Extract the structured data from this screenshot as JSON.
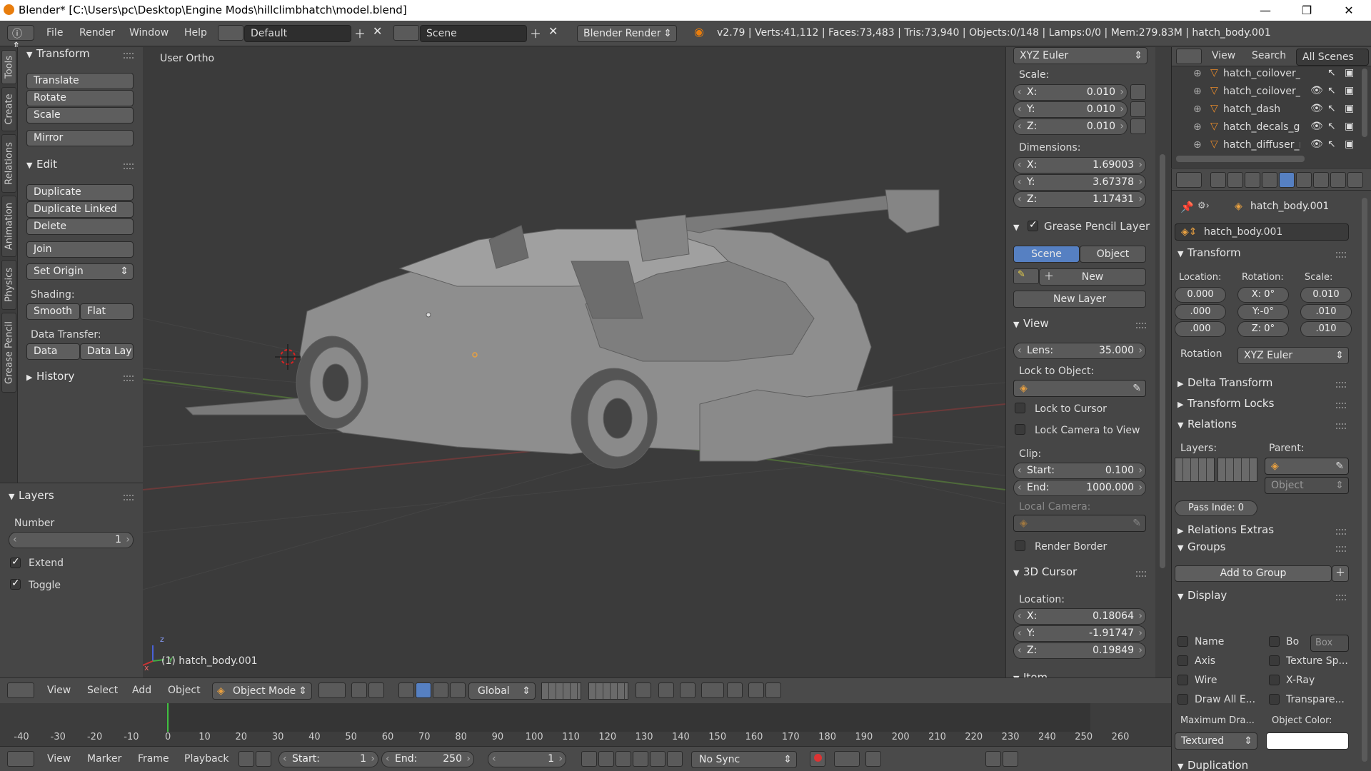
{
  "window": {
    "title": "Blender* [C:\\Users\\pc\\Desktop\\Engine Mods\\hillclimbhatch\\model.blend]",
    "minimize": "—",
    "maximize": "❐",
    "close": "✕"
  },
  "info_header": {
    "menus": [
      "File",
      "Render",
      "Window",
      "Help"
    ],
    "layout": "Default",
    "scene": "Scene",
    "engine": "Blender Render",
    "stats": "v2.79 | Verts:41,112 | Faces:73,483 | Tris:73,940 | Objects:0/148 | Lamps:0/0 | Mem:279.83M | hatch_body.001"
  },
  "side_tabs": [
    "Tools",
    "Create",
    "Relations",
    "Animation",
    "Physics",
    "Grease Pencil"
  ],
  "tool_shelf": {
    "transform": {
      "title": "Transform",
      "buttons": [
        "Translate",
        "Rotate",
        "Scale",
        "Mirror"
      ]
    },
    "edit": {
      "title": "Edit",
      "buttons": [
        "Duplicate",
        "Duplicate Linked",
        "Delete",
        "Join"
      ],
      "set_origin": "Set Origin"
    },
    "shading": {
      "label": "Shading:",
      "smooth": "Smooth",
      "flat": "Flat"
    },
    "data_transfer": {
      "label": "Data Transfer:",
      "data": "Data",
      "data_lay": "Data Lay"
    },
    "history": "History",
    "layers": {
      "title": "Layers",
      "number_label": "Number",
      "number_value": "1",
      "extend": "Extend",
      "toggle": "Toggle"
    }
  },
  "viewport": {
    "view_name": "User Ortho",
    "object_label": "(1) hatch_body.001",
    "axis_x": "x",
    "axis_y": "y",
    "axis_z": "z"
  },
  "n_panel": {
    "rotation_mode": "XYZ Euler",
    "scale_label": "Scale:",
    "scale": [
      {
        "k": "X:",
        "v": "0.010"
      },
      {
        "k": "Y:",
        "v": "0.010"
      },
      {
        "k": "Z:",
        "v": "0.010"
      }
    ],
    "dimensions_label": "Dimensions:",
    "dimensions": [
      {
        "k": "X:",
        "v": "1.69003"
      },
      {
        "k": "Y:",
        "v": "3.67378"
      },
      {
        "k": "Z:",
        "v": "1.17431"
      }
    ],
    "grease_pencil": {
      "title": "Grease Pencil Layer",
      "scene": "Scene",
      "object": "Object",
      "new": "New",
      "new_layer": "New Layer"
    },
    "view": {
      "title": "View",
      "lens_k": "Lens:",
      "lens_v": "35.000",
      "lock_to_object": "Lock to Object:",
      "lock_to_cursor": "Lock to Cursor",
      "lock_camera": "Lock Camera to View",
      "clip_label": "Clip:",
      "start_k": "Start:",
      "start_v": "0.100",
      "end_k": "End:",
      "end_v": "1000.000",
      "local_camera": "Local Camera:",
      "render_border": "Render Border"
    },
    "cursor": {
      "title": "3D Cursor",
      "location_label": "Location:",
      "x": "0.18064",
      "y": "-1.91747",
      "z": "0.19849"
    },
    "item": "Item"
  },
  "outliner": {
    "view": "View",
    "search": "Search",
    "all_scenes": "All Scenes",
    "rows": [
      "hatch_coilover_R",
      "hatch_coilover_R",
      "hatch_dash",
      "hatch_decals_gau",
      "hatch_diffuser_ra"
    ]
  },
  "properties": {
    "breadcrumb": "hatch_body.001",
    "object_name": "hatch_body.001",
    "transform": {
      "title": "Transform",
      "location_label": "Location:",
      "rotation_label": "Rotation:",
      "scale_label": "Scale:",
      "location": [
        "0.000",
        ".000",
        ".000"
      ],
      "rotation": [
        "X: 0°",
        "Y:-0°",
        "Z: 0°"
      ],
      "scale": [
        "0.010",
        ".010",
        ".010"
      ],
      "rotation_mode_label": "Rotation",
      "rotation_mode": "XYZ Euler"
    },
    "delta_transform": "Delta Transform",
    "transform_locks": "Transform Locks",
    "relations": {
      "title": "Relations",
      "layers_label": "Layers:",
      "parent_label": "Parent:",
      "parent_type": "Object",
      "pass_index": "Pass Inde: 0"
    },
    "relations_extras": "Relations Extras",
    "groups": {
      "title": "Groups",
      "add_to_group": "Add to Group"
    },
    "display": {
      "title": "Display",
      "name": "Name",
      "bo": "Bo",
      "box": "Box",
      "axis": "Axis",
      "texture_sp": "Texture Sp...",
      "wire": "Wire",
      "xray": "X-Ray",
      "draw_all": "Draw All E...",
      "transparent": "Transpare...",
      "max_draw_label": "Maximum Dra...",
      "object_color_label": "Object Color:",
      "max_draw": "Textured"
    },
    "duplication": "Duplication"
  },
  "view3d_header": {
    "menus": [
      "View",
      "Select",
      "Add",
      "Object"
    ],
    "mode": "Object Mode",
    "orientation": "Global"
  },
  "timeline": {
    "ticks": [
      "-40",
      "-30",
      "-20",
      "-10",
      "0",
      "10",
      "20",
      "30",
      "40",
      "50",
      "60",
      "70",
      "80",
      "90",
      "100",
      "110",
      "120",
      "130",
      "140",
      "150",
      "160",
      "170",
      "180",
      "190",
      "200",
      "210",
      "220",
      "230",
      "240",
      "250",
      "260"
    ],
    "current_frame": 0
  },
  "timeline_header": {
    "menus": [
      "View",
      "Marker",
      "Frame",
      "Playback"
    ],
    "start_k": "Start:",
    "start_v": "1",
    "end_k": "End:",
    "end_v": "250",
    "frame": "1",
    "sync": "No Sync"
  }
}
